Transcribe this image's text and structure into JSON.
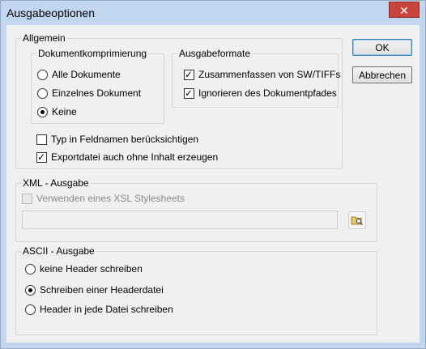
{
  "window": {
    "title": "Ausgabeoptionen",
    "close_glyph": "✕"
  },
  "buttons": {
    "ok": "OK",
    "cancel": "Abbrechen"
  },
  "allgemein": {
    "label": "Allgemein",
    "compression": {
      "label": "Dokumentkomprimierung",
      "options": [
        {
          "label": "Alle Dokumente",
          "selected": false
        },
        {
          "label": "Einzelnes Dokument",
          "selected": false
        },
        {
          "label": "Keine",
          "selected": true
        }
      ]
    },
    "formats": {
      "label": "Ausgabeformate",
      "options": [
        {
          "label": "Zusammenfassen von SW/TIFFs",
          "checked": true
        },
        {
          "label": "Ignorieren des Dokumentpfades",
          "checked": true
        }
      ]
    },
    "checks": [
      {
        "label": "Typ in Feldnamen berücksichtigen",
        "checked": false
      },
      {
        "label": "Exportdatei auch ohne Inhalt erzeugen",
        "checked": true
      }
    ]
  },
  "xml": {
    "label": "XML - Ausgabe",
    "use_xsl": {
      "label": "Verwenden eines XSL Stylesheets",
      "checked": false,
      "enabled": false
    },
    "path_value": "",
    "browse_icon": "folder-search-icon"
  },
  "ascii": {
    "label": "ASCII - Ausgabe",
    "options": [
      {
        "label": "keine Header schreiben",
        "selected": false
      },
      {
        "label": "Schreiben einer Headerdatei",
        "selected": true
      },
      {
        "label": "Header in jede Datei schreiben",
        "selected": false
      }
    ]
  }
}
